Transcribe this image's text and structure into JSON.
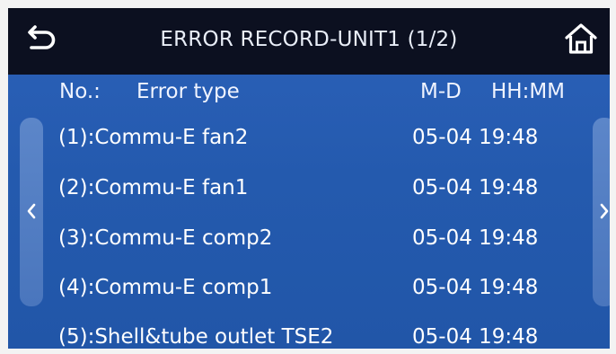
{
  "header": {
    "title": "ERROR RECORD-UNIT1 (1/2)",
    "back_icon": "back-arrow-icon",
    "home_icon": "home-icon"
  },
  "columns": {
    "no": "No.:",
    "type": "Error type",
    "date": "M-D",
    "time": "HH:MM"
  },
  "records": [
    {
      "type": "(1):Commu-E fan2",
      "datetime": "05-04 19:48"
    },
    {
      "type": "(2):Commu-E fan1",
      "datetime": "05-04 19:48"
    },
    {
      "type": "(3):Commu-E comp2",
      "datetime": "05-04 19:48"
    },
    {
      "type": "(4):Commu-E comp1",
      "datetime": "05-04 19:48"
    },
    {
      "type": "(5):Shell&tube outlet TSE2",
      "datetime": "05-04 19:48"
    }
  ],
  "nav": {
    "prev_icon": "chevron-left-icon",
    "next_icon": "chevron-right-icon"
  },
  "colors": {
    "topbar": "#0c1020",
    "background": "#2a5fb5",
    "text": "#ffffff"
  }
}
